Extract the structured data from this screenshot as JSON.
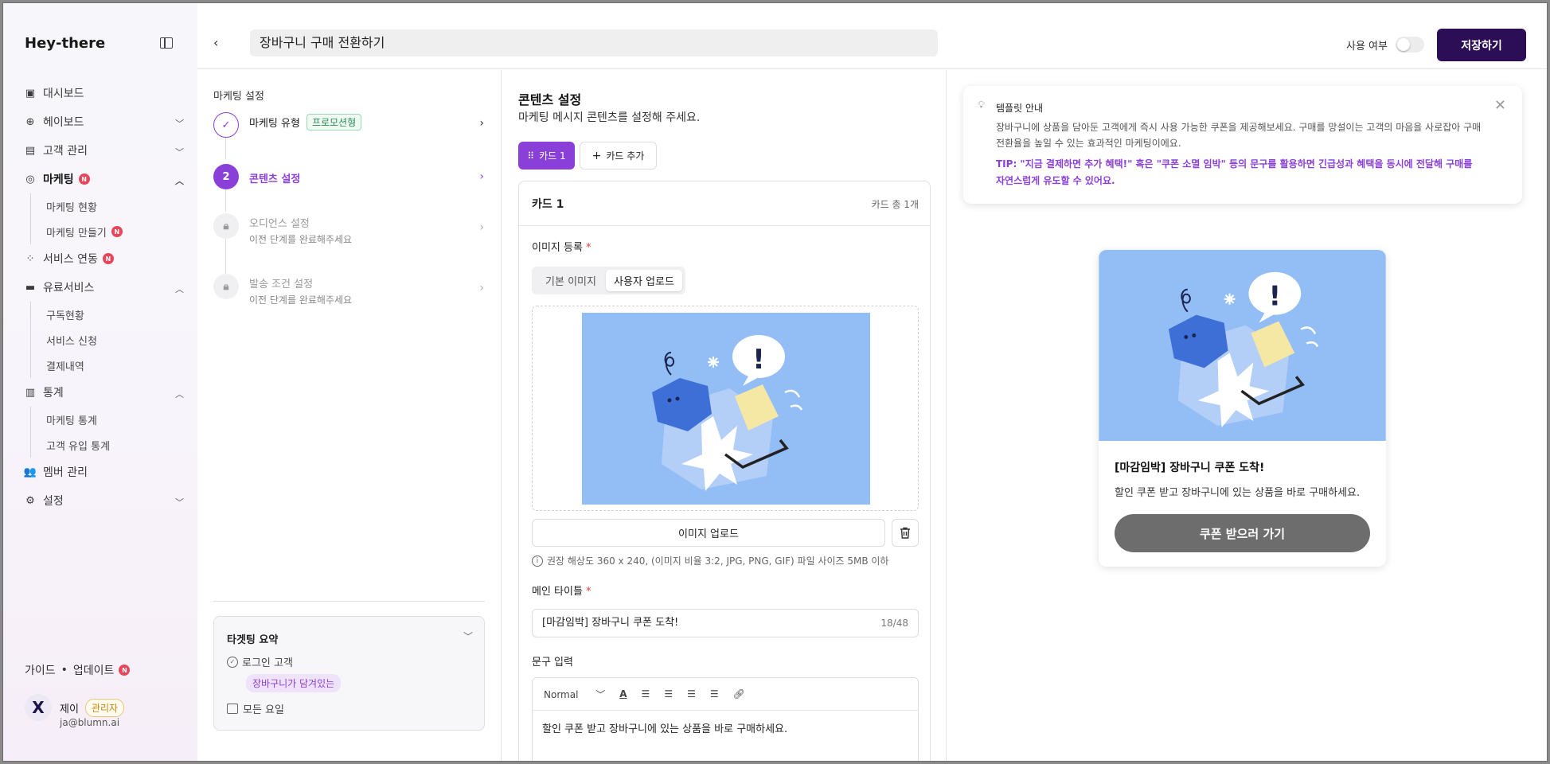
{
  "app": {
    "logo": "Hey-there"
  },
  "sidebar": {
    "items": [
      {
        "label": "대시보드"
      },
      {
        "label": "헤이보드"
      },
      {
        "label": "고객 관리"
      },
      {
        "label": "마케팅",
        "badge": "N"
      },
      {
        "label": "서비스 연동",
        "badge": "N"
      },
      {
        "label": "유료서비스"
      },
      {
        "label": "통계"
      },
      {
        "label": "멤버 관리"
      },
      {
        "label": "설정"
      }
    ],
    "marketing_sub": [
      {
        "label": "마케팅 현황"
      },
      {
        "label": "마케팅 만들기",
        "badge": "N"
      }
    ],
    "paid_sub": [
      {
        "label": "구독현황"
      },
      {
        "label": "서비스 신청"
      },
      {
        "label": "결제내역"
      }
    ],
    "stats_sub": [
      {
        "label": "마케팅 통계"
      },
      {
        "label": "고객 유입 통계"
      }
    ],
    "guide": "가이드",
    "update": "업데이트",
    "update_badge": "N",
    "user": {
      "name": "제이",
      "role": "관리자",
      "email": "ja@blumn.ai",
      "avatar": "X"
    }
  },
  "topbar": {
    "title_value": "장바구니 구매 전환하기",
    "toggle_label": "사용 여부",
    "save_label": "저장하기"
  },
  "steps": {
    "panel_title": "마케팅 설정",
    "items": [
      {
        "label": "마케팅 유형",
        "tag": "프로모션형",
        "state": "done"
      },
      {
        "num": "2",
        "label": "콘텐츠 설정",
        "state": "active"
      },
      {
        "label": "오디언스 설정",
        "sub": "이전 단계를 완료해주세요",
        "state": "locked"
      },
      {
        "label": "발송 조건 설정",
        "sub": "이전 단계를 완료해주세요",
        "state": "locked"
      }
    ]
  },
  "summary": {
    "title": "타겟팅 요약",
    "login": "로그인 고객",
    "cart_tag": "장바구니가 담겨있는",
    "days": "모든 요일"
  },
  "content": {
    "title": "콘텐츠 설정",
    "subtitle": "마케팅 메시지 콘텐츠를 설정해 주세요.",
    "card_tab": "카드 1",
    "add_card": "카드 추가",
    "card_name": "카드 1",
    "card_total": "카드 총 1개",
    "image_label": "이미지 등록",
    "seg_default": "기본 이미지",
    "seg_user": "사용자 업로드",
    "upload_label": "이미지 업로드",
    "hint": "권장 해상도 360 x 240, (이미지 비율 3:2, JPG, PNG, GIF) 파일 사이즈 5MB 이하",
    "main_title_label": "메인 타이틀",
    "main_title_value": "[마감임박] 장바구니 쿠폰 도착!",
    "main_title_count": "18/48",
    "body_label": "문구 입력",
    "font_style": "Normal",
    "body_value": "할인 쿠폰 받고 장바구니에 있는 상품을 바로 구매하세요."
  },
  "template": {
    "title": "템플릿 안내",
    "body": "장바구니에 상품을 담아둔 고객에게 즉시 사용 가능한 쿠폰을 제공해보세요. 구매를 망설이는 고객의 마음을 사로잡아 구매 전환율을 높일 수 있는 효과적인 마케팅이에요.",
    "tip": "TIP: \"지금 결제하면 추가 혜택!\" 혹은 \"쿠폰 소멸 임박\" 등의 문구를 활용하면 긴급성과 혜택을 동시에 전달해 구매를 자연스럽게 유도할 수 있어요."
  },
  "preview": {
    "title": "[마감임박] 장바구니 쿠폰 도착!",
    "desc": "할인 쿠폰 받고 장바구니에 있는 상품을 바로 구매하세요.",
    "button": "쿠폰 받으러 가기"
  },
  "colors": {
    "accent": "#8b3fd9",
    "primary": "#2b0e55",
    "illustration_bg": "#93bdf5"
  }
}
